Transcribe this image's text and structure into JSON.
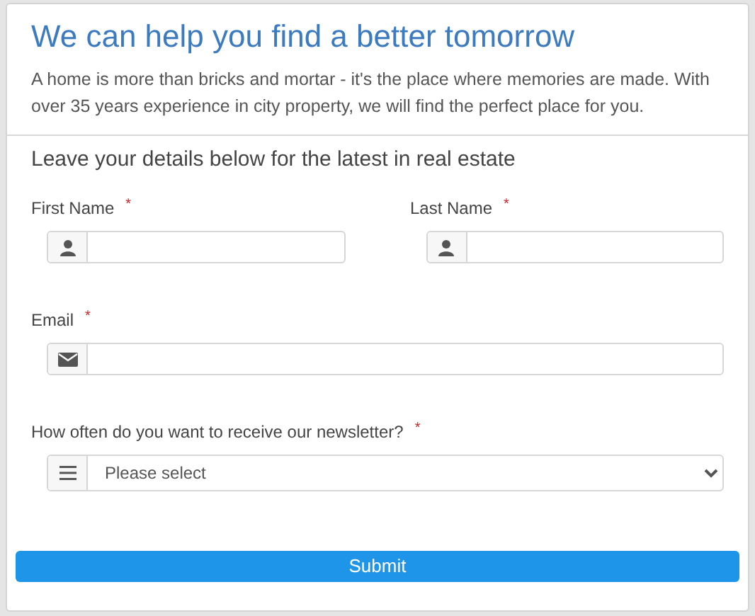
{
  "header": {
    "title": "We can help you find a better tomorrow",
    "intro": "A home is more than bricks and mortar - it's the place where memories are made. With over 35 years experience in city property, we will find the perfect place for you."
  },
  "form": {
    "heading": "Leave your details below for the latest in real estate",
    "rows": [
      [
        {
          "label": "First Name",
          "required_mark": "*",
          "kind": "user"
        },
        {
          "label": "Last Name",
          "required_mark": "*",
          "kind": "user"
        }
      ],
      [
        {
          "label": "Email",
          "required_mark": "*",
          "kind": "email"
        }
      ],
      [
        {
          "label": "How often do you want to receive our newsletter?",
          "required_mark": "*",
          "kind": "select",
          "value": "Please select"
        }
      ]
    ],
    "submit": "Submit"
  }
}
